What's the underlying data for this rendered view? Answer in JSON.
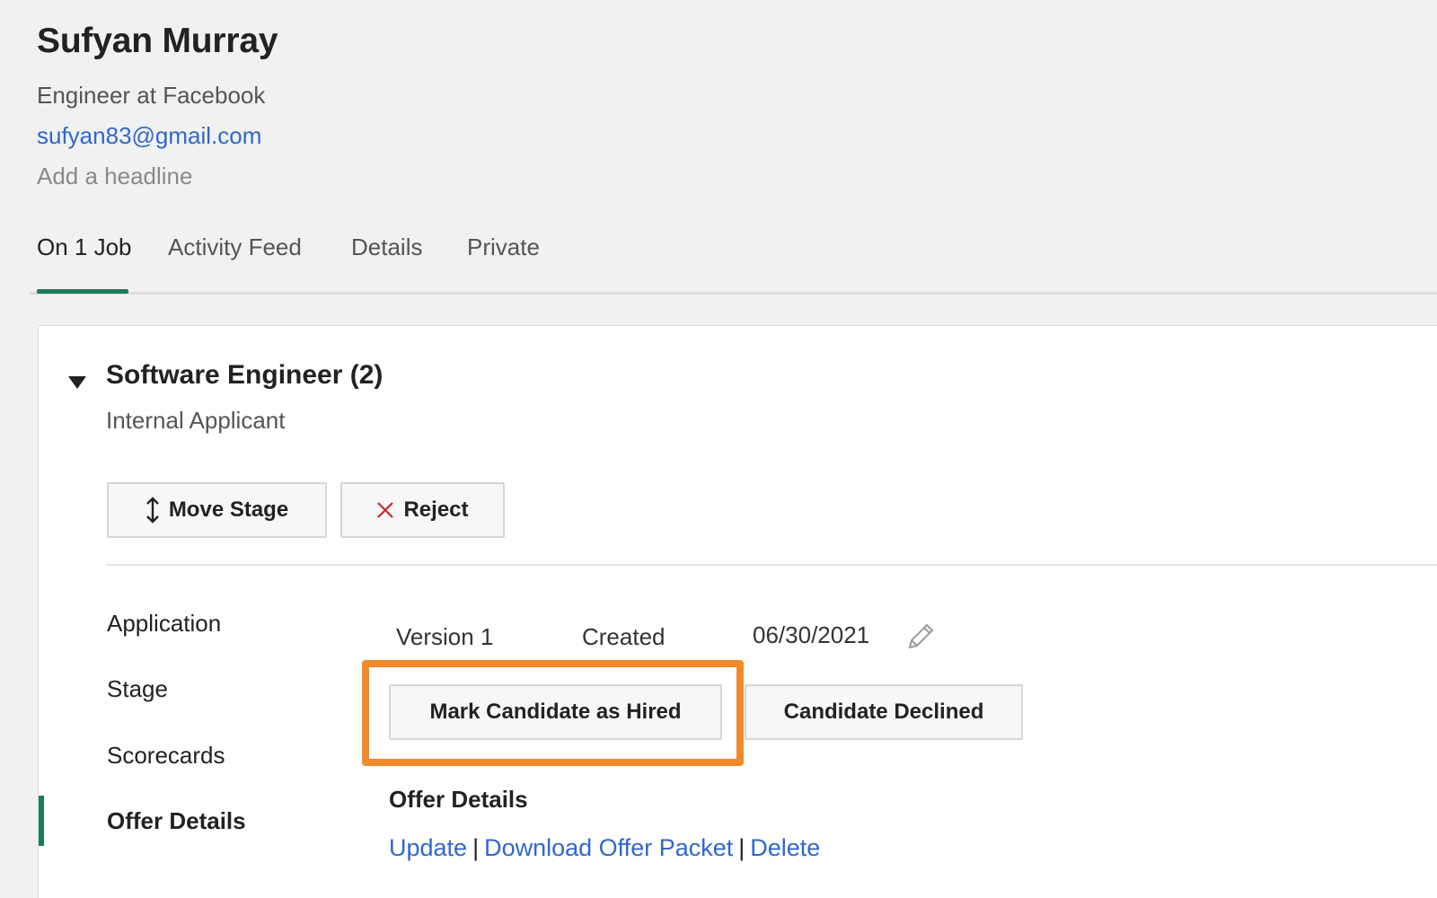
{
  "candidate": {
    "name": "Sufyan Murray",
    "subtitle": "Engineer at Facebook",
    "email": "sufyan83@gmail.com",
    "headline_placeholder": "Add a headline"
  },
  "tabs": [
    {
      "label": "On 1 Job",
      "active": true
    },
    {
      "label": "Activity Feed",
      "active": false
    },
    {
      "label": "Details",
      "active": false
    },
    {
      "label": "Private",
      "active": false
    }
  ],
  "job": {
    "title": "Software Engineer (2)",
    "subtitle": "Internal Applicant",
    "move_stage_label": "Move Stage",
    "reject_label": "Reject"
  },
  "sidebar": {
    "items": [
      {
        "label": "Application"
      },
      {
        "label": "Stage"
      },
      {
        "label": "Scorecards"
      },
      {
        "label": "Offer Details",
        "active": true
      }
    ]
  },
  "offer": {
    "version": "Version 1",
    "created_label": "Created",
    "created_date": "06/30/2021",
    "mark_hired_label": "Mark Candidate as Hired",
    "declined_label": "Candidate Declined",
    "heading": "Offer Details",
    "links": {
      "update": "Update",
      "download": "Download Offer Packet",
      "delete": "Delete",
      "separator": "|"
    }
  },
  "colors": {
    "accent_green": "#1d7a5a",
    "link_blue": "#3168c9",
    "highlight_orange": "#f0892b",
    "reject_red": "#c8282b"
  },
  "icons": {
    "move": "up-down-arrow-icon",
    "reject": "close-x-icon",
    "edit": "pencil-icon",
    "collapse": "triangle-down-icon"
  }
}
